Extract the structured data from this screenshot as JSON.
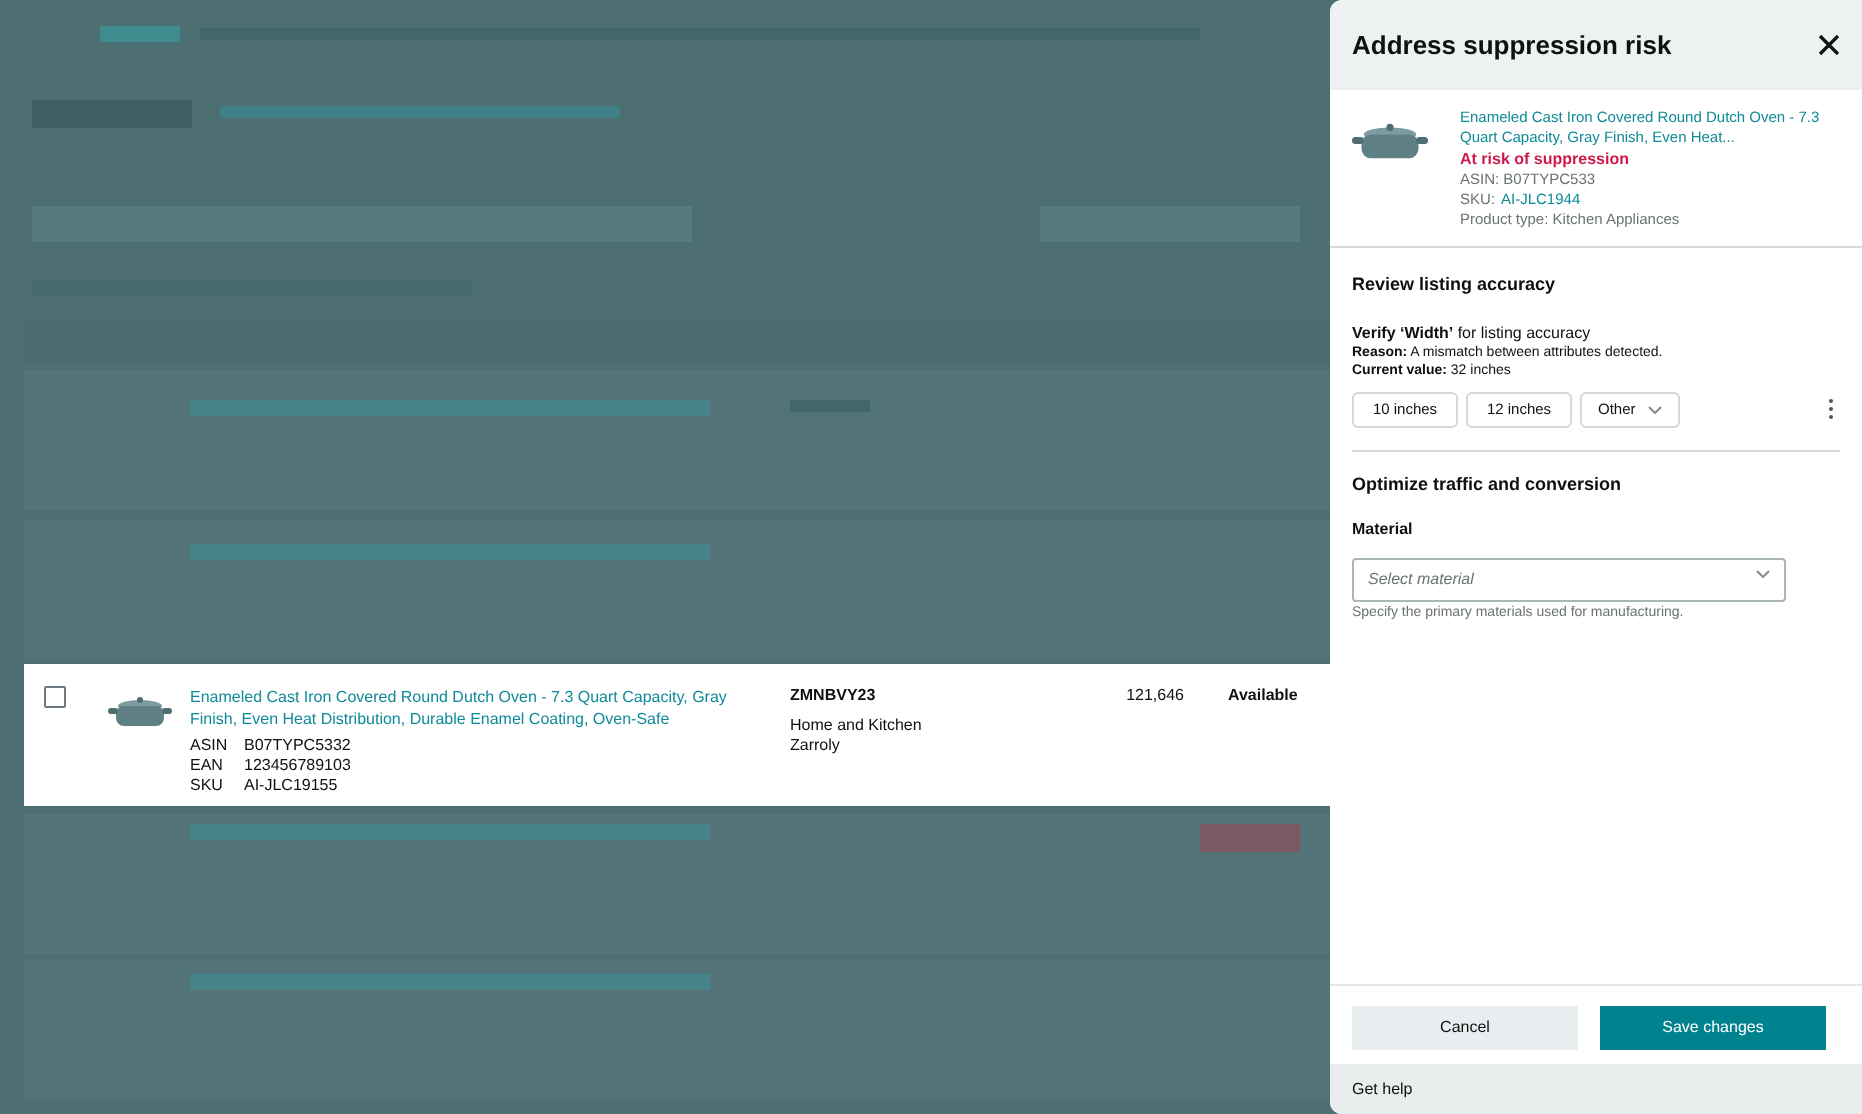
{
  "row": {
    "checked": false,
    "title": "Enameled Cast Iron Covered Round Dutch Oven - 7.3 Quart Capacity, Gray Finish, Even Heat Distribution, Durable Enamel Coating, Oven-Safe",
    "identifiers": [
      {
        "label": "ASIN",
        "value": "B07TYPC5332"
      },
      {
        "label": "EAN",
        "value": "123456789103"
      },
      {
        "label": "SKU",
        "value": "AI-JLC19155"
      }
    ],
    "seller_sku": "ZMNBVY23",
    "category": "Home and Kitchen",
    "brand": "Zarroly",
    "count": "121,646",
    "availability": "Available"
  },
  "panel": {
    "title": "Address suppression risk",
    "product": {
      "title": "Enameled Cast Iron Covered Round Dutch Oven - 7.3 Quart Capacity, Gray Finish, Even Heat...",
      "status": "At risk of suppression",
      "asin": "ASIN: B07TYPC533",
      "sku_label": "SKU:",
      "sku": "AI-JLC1944",
      "product_type": "Product type: Kitchen Appliances"
    },
    "review": {
      "heading": "Review listing accuracy",
      "verify": "**Verify ‘Width’** for listing accuracy",
      "reason": "**Reason:** A mismatch between attributes detected.",
      "current": "**Current value:** 32 inches",
      "options": [
        {
          "label": "10 inches",
          "kind": "button"
        },
        {
          "label": "12 inches",
          "kind": "button"
        },
        {
          "label": "Other",
          "kind": "dropdown"
        }
      ]
    },
    "optimize": {
      "heading": "Optimize traffic and conversion",
      "field_label": "Material",
      "placeholder": "Select material",
      "hint": "Specify the primary materials used for manufacturing."
    },
    "buttons": {
      "cancel": "Cancel",
      "save": "Save changes"
    },
    "help": "Get help"
  }
}
